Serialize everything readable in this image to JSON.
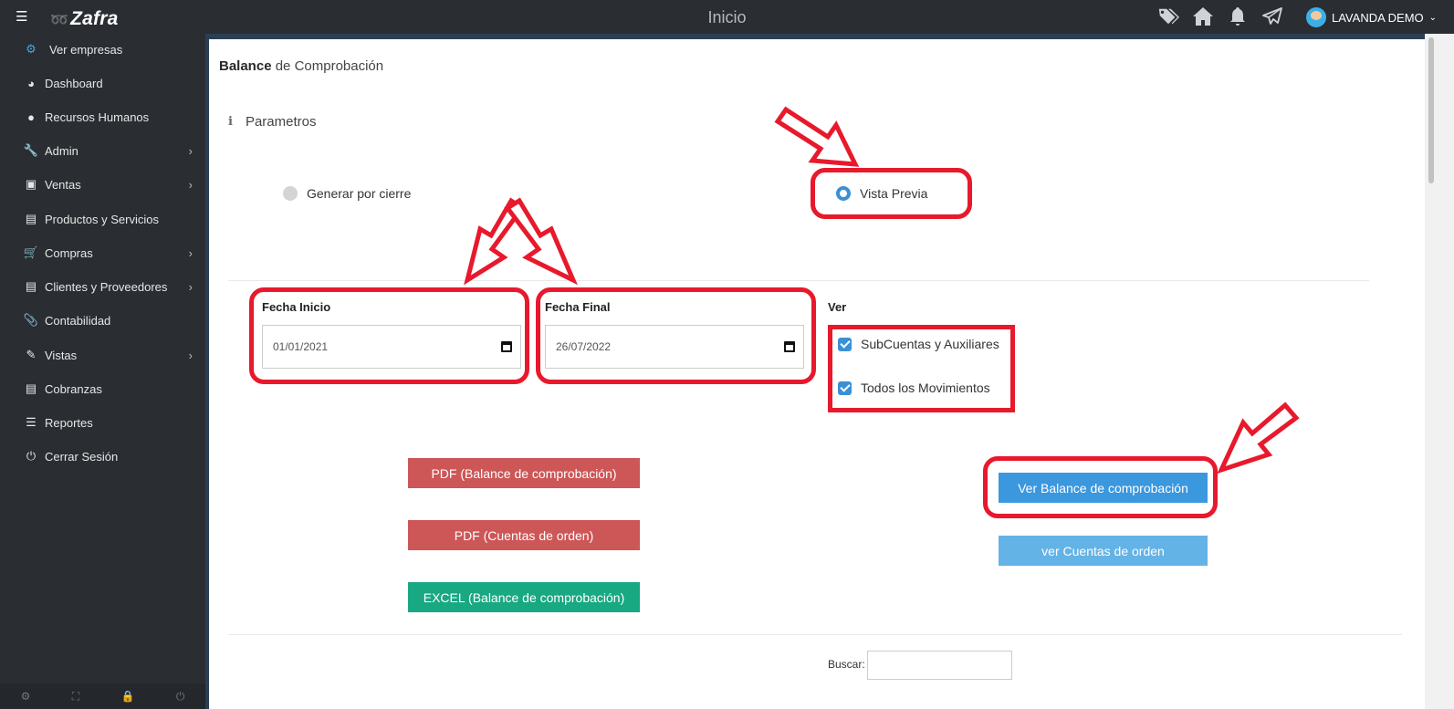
{
  "header": {
    "logo_text": "Zafra",
    "page_title": "Inicio",
    "user_name": "LAVANDA DEMO"
  },
  "sidebar": {
    "items": [
      {
        "label": "Ver empresas",
        "icon": "gears-icon",
        "has_submenu": false
      },
      {
        "label": "Dashboard",
        "icon": "dashboard-icon",
        "has_submenu": false
      },
      {
        "label": "Recursos Humanos",
        "icon": "user-icon",
        "has_submenu": false
      },
      {
        "label": "Admin",
        "icon": "wrench-icon",
        "has_submenu": true
      },
      {
        "label": "Ventas",
        "icon": "money-icon",
        "has_submenu": true
      },
      {
        "label": "Productos y Servicios",
        "icon": "book-icon",
        "has_submenu": false
      },
      {
        "label": "Compras",
        "icon": "cart-icon",
        "has_submenu": true
      },
      {
        "label": "Clientes y Proveedores",
        "icon": "book-icon",
        "has_submenu": true
      },
      {
        "label": "Contabilidad",
        "icon": "paperclip-icon",
        "has_submenu": false
      },
      {
        "label": "Vistas",
        "icon": "edit-icon",
        "has_submenu": true
      },
      {
        "label": "Cobranzas",
        "icon": "book-icon",
        "has_submenu": false
      },
      {
        "label": "Reportes",
        "icon": "list-icon",
        "has_submenu": false
      },
      {
        "label": "Cerrar Sesión",
        "icon": "power-icon",
        "has_submenu": false
      }
    ],
    "footer_icons": [
      "settings-icon",
      "fullscreen-icon",
      "lock-icon",
      "logout-icon"
    ]
  },
  "panel": {
    "title_bold": "Balance",
    "title_rest": " de Comprobación",
    "section_label": "Parametros",
    "radio_generar": "Generar por cierre",
    "radio_vista": "Vista Previa",
    "fecha_inicio_label": "Fecha Inicio",
    "fecha_inicio_value": "01/01/2021",
    "fecha_final_label": "Fecha Final",
    "fecha_final_value": "26/07/2022",
    "ver_label": "Ver",
    "check_subcuentas": "SubCuentas y Auxiliares",
    "check_movimientos": "Todos los Movimientos",
    "btn_pdf_balance": "PDF (Balance de comprobación)",
    "btn_pdf_cuentas": "PDF (Cuentas de orden)",
    "btn_excel_balance": "EXCEL (Balance de comprobación)",
    "btn_ver_balance": "Ver Balance de comprobación",
    "btn_ver_cuentas": "ver Cuentas de orden",
    "search_label": "Buscar:"
  },
  "colors": {
    "sidebar_bg": "#2a2d32",
    "accent_blue": "#3b97de",
    "btn_red": "#cd5657",
    "btn_green": "#18a882",
    "annotation_red": "#e8192c"
  }
}
